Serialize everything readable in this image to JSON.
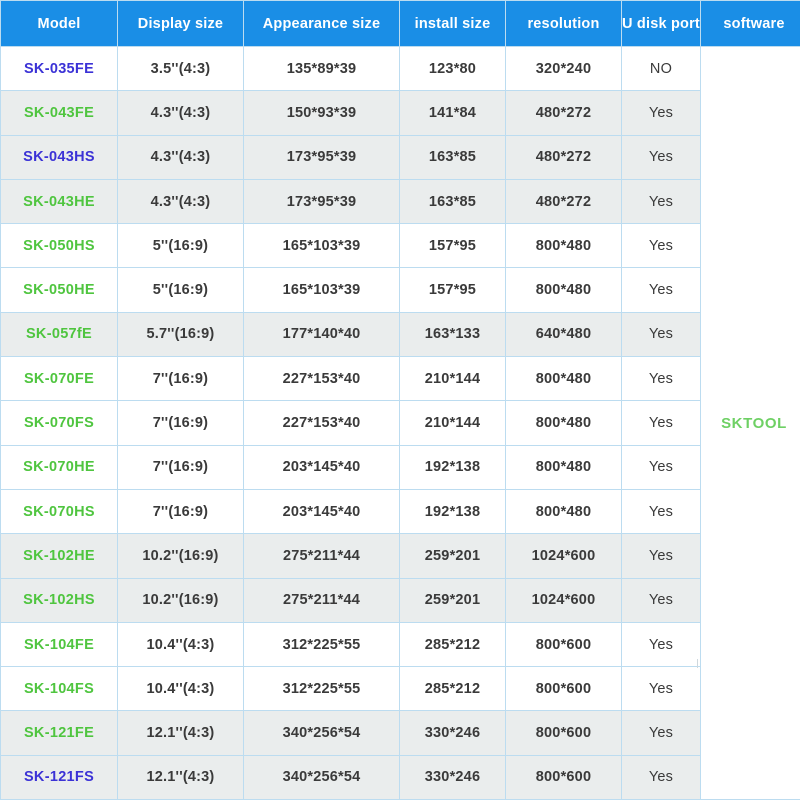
{
  "table": {
    "columns": [
      {
        "key": "model",
        "label": "Model"
      },
      {
        "key": "display",
        "label": "Display size"
      },
      {
        "key": "appearance",
        "label": "Appearance size"
      },
      {
        "key": "install",
        "label": "install size"
      },
      {
        "key": "resolution",
        "label": "resolution"
      },
      {
        "key": "usb",
        "label": "U disk port"
      },
      {
        "key": "software",
        "label": "software"
      }
    ],
    "software_value": "SKTOOL",
    "colors": {
      "header_background": "#1a8ee6",
      "header_text": "#ffffff",
      "border": "#bcdcf0",
      "row_white": "#ffffff",
      "row_shaded": "#eaeded",
      "model_blue": "#3b32d6",
      "model_green": "#4fc53f",
      "data_text": "#3a3a3a",
      "software_text": "#6ed064"
    },
    "rows": [
      {
        "model": "SK-035FE",
        "model_color": "blue",
        "shade": "white",
        "display": "3.5''(4:3)",
        "appearance": "135*89*39",
        "install": "123*80",
        "resolution": "320*240",
        "usb": "NO"
      },
      {
        "model": "SK-043FE",
        "model_color": "green",
        "shade": "shade",
        "display": "4.3''(4:3)",
        "appearance": "150*93*39",
        "install": "141*84",
        "resolution": "480*272",
        "usb": "Yes"
      },
      {
        "model": "SK-043HS",
        "model_color": "blue",
        "shade": "shade",
        "display": "4.3''(4:3)",
        "appearance": "173*95*39",
        "install": "163*85",
        "resolution": "480*272",
        "usb": "Yes"
      },
      {
        "model": "SK-043HE",
        "model_color": "green",
        "shade": "shade",
        "display": "4.3''(4:3)",
        "appearance": "173*95*39",
        "install": "163*85",
        "resolution": "480*272",
        "usb": "Yes"
      },
      {
        "model": "SK-050HS",
        "model_color": "green",
        "shade": "white",
        "display": "5''(16:9)",
        "appearance": "165*103*39",
        "install": "157*95",
        "resolution": "800*480",
        "usb": "Yes"
      },
      {
        "model": "SK-050HE",
        "model_color": "green",
        "shade": "white",
        "display": "5''(16:9)",
        "appearance": "165*103*39",
        "install": "157*95",
        "resolution": "800*480",
        "usb": "Yes"
      },
      {
        "model": "SK-057fE",
        "model_color": "green",
        "shade": "shade",
        "display": "5.7''(16:9)",
        "appearance": "177*140*40",
        "install": "163*133",
        "resolution": "640*480",
        "usb": "Yes"
      },
      {
        "model": "SK-070FE",
        "model_color": "green",
        "shade": "white",
        "display": "7''(16:9)",
        "appearance": "227*153*40",
        "install": "210*144",
        "resolution": "800*480",
        "usb": "Yes"
      },
      {
        "model": "SK-070FS",
        "model_color": "green",
        "shade": "white",
        "display": "7''(16:9)",
        "appearance": "227*153*40",
        "install": "210*144",
        "resolution": "800*480",
        "usb": "Yes"
      },
      {
        "model": "SK-070HE",
        "model_color": "green",
        "shade": "white",
        "display": "7''(16:9)",
        "appearance": "203*145*40",
        "install": "192*138",
        "resolution": "800*480",
        "usb": "Yes"
      },
      {
        "model": "SK-070HS",
        "model_color": "green",
        "shade": "white",
        "display": "7''(16:9)",
        "appearance": "203*145*40",
        "install": "192*138",
        "resolution": "800*480",
        "usb": "Yes"
      },
      {
        "model": "SK-102HE",
        "model_color": "green",
        "shade": "shade",
        "display": "10.2''(16:9)",
        "appearance": "275*211*44",
        "install": "259*201",
        "resolution": "1024*600",
        "usb": "Yes"
      },
      {
        "model": "SK-102HS",
        "model_color": "green",
        "shade": "shade",
        "display": "10.2''(16:9)",
        "appearance": "275*211*44",
        "install": "259*201",
        "resolution": "1024*600",
        "usb": "Yes"
      },
      {
        "model": "SK-104FE",
        "model_color": "green",
        "shade": "white",
        "display": "10.4''(4:3)",
        "appearance": "312*225*55",
        "install": "285*212",
        "resolution": "800*600",
        "usb": "Yes"
      },
      {
        "model": "SK-104FS",
        "model_color": "green",
        "shade": "white",
        "display": "10.4''(4:3)",
        "appearance": "312*225*55",
        "install": "285*212",
        "resolution": "800*600",
        "usb": "Yes"
      },
      {
        "model": "SK-121FE",
        "model_color": "green",
        "shade": "shade",
        "display": "12.1''(4:3)",
        "appearance": "340*256*54",
        "install": "330*246",
        "resolution": "800*600",
        "usb": "Yes"
      },
      {
        "model": "SK-121FS",
        "model_color": "blue",
        "shade": "shade",
        "display": "12.1''(4:3)",
        "appearance": "340*256*54",
        "install": "330*246",
        "resolution": "800*600",
        "usb": "Yes"
      }
    ]
  }
}
